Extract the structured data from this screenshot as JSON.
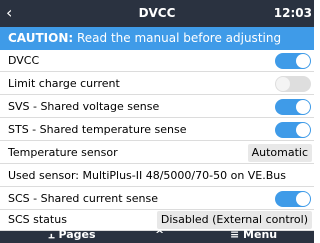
{
  "header": {
    "back_icon": "‹",
    "title": "DVCC",
    "clock": "12:03"
  },
  "caution": {
    "strong": "CAUTION:",
    "text": " Read the manual before adjusting"
  },
  "rows": [
    {
      "label": "DVCC",
      "toggle": "on"
    },
    {
      "label": "Limit charge current",
      "toggle": "off"
    },
    {
      "label": "SVS - Shared voltage sense",
      "toggle": "on"
    },
    {
      "label": "STS - Shared temperature sense",
      "toggle": "on"
    },
    {
      "label": "Temperature sensor",
      "value": "Automatic"
    },
    {
      "label": "Used sensor: MultiPlus-II 48/5000/70-50 on VE.Bus"
    },
    {
      "label": "SCS - Shared current sense",
      "toggle": "on"
    },
    {
      "label": "SCS status",
      "value": "Disabled (External control)"
    }
  ],
  "footer": {
    "pages_label": "⫠ Pages",
    "up_icon": "^",
    "menu_label": "≡ Menu"
  },
  "colors": {
    "titlebar": "#2a3240",
    "accent": "#3f9be8"
  }
}
